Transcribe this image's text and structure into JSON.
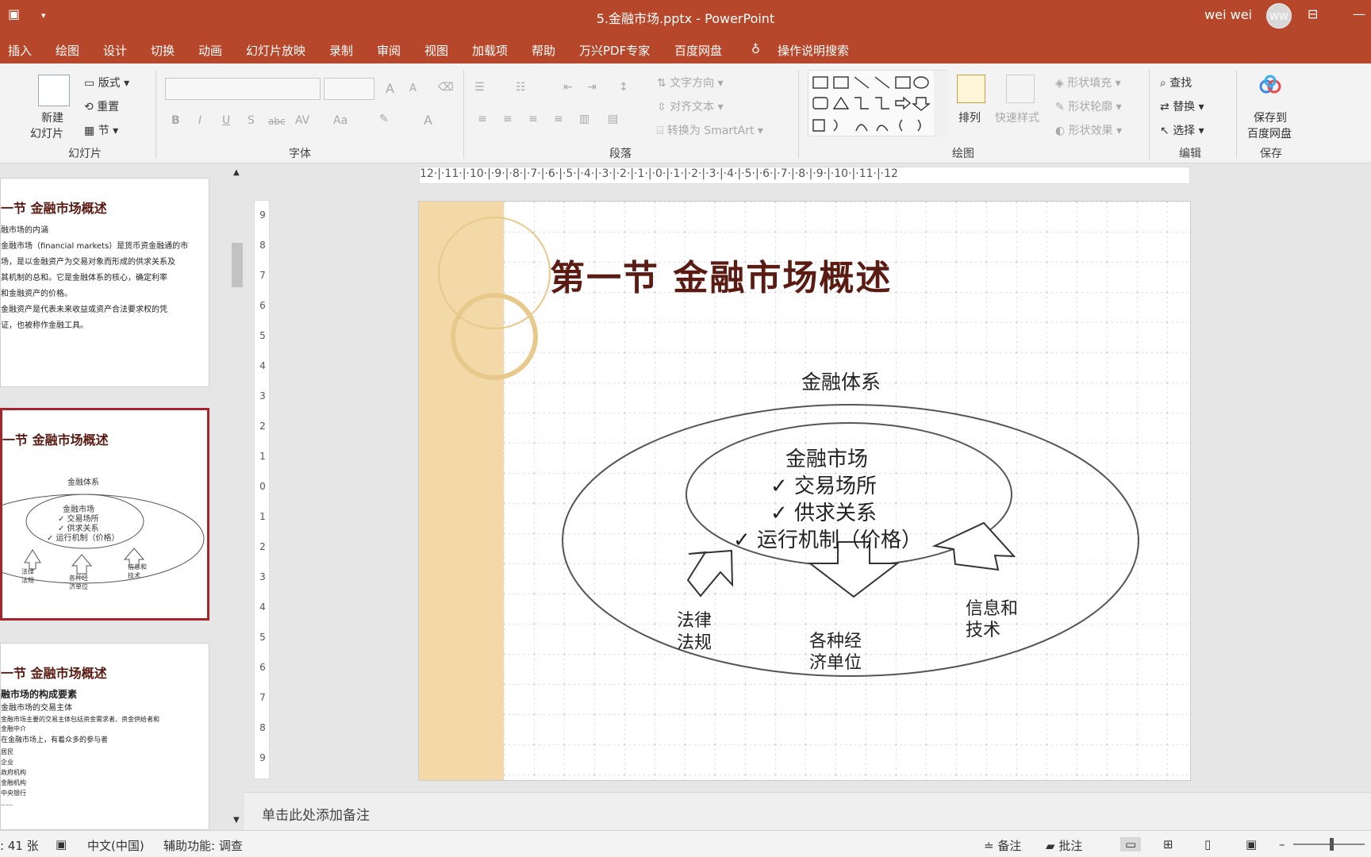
{
  "window": {
    "doc_title": "5.金融市场.pptx  -  PowerPoint",
    "user": "wei wei",
    "avatar": "WW"
  },
  "tabs": [
    "插入",
    "绘图",
    "设计",
    "切换",
    "动画",
    "幻灯片放映",
    "录制",
    "审阅",
    "视图",
    "加载项",
    "帮助",
    "万兴PDF专家",
    "百度网盘"
  ],
  "tell_me": "操作说明搜索",
  "ribbon": {
    "slides": {
      "new_slide_1": "新建",
      "new_slide_2": "幻灯片",
      "layout": "版式",
      "reset": "重置",
      "section": "节",
      "label": "幻灯片"
    },
    "font": {
      "label": "字体",
      "bold": "B",
      "italic": "I",
      "underline": "U",
      "shadow": "S",
      "strike": "abc",
      "spacing": "AV",
      "case": "Aa",
      "grow": "A",
      "shrink": "A",
      "color": "A"
    },
    "paragraph": {
      "label": "段落",
      "text_direction": "文字方向",
      "align_text": "对齐文本",
      "smartart": "转换为 SmartArt"
    },
    "drawing": {
      "label": "绘图",
      "arrange": "排列",
      "quick_styles": "快速样式",
      "fill": "形状填充",
      "outline": "形状轮廓",
      "effects": "形状效果"
    },
    "editing": {
      "label": "编辑",
      "find": "查找",
      "replace": "替换",
      "select": "选择"
    },
    "save": {
      "label": "保存",
      "btn_1": "保存到",
      "btn_2": "百度网盘"
    }
  },
  "thumbnails": [
    {
      "title": "一节 金融市场概述",
      "lines": [
        "融市场的内涵",
        "金融市场（financial markets）是货币资金融通的市",
        "场，是以金融资产为交易对象而形成的供求关系及",
        "其机制的总和。它是金融体系的核心，确定利率",
        "和金融资产的价格。",
        "金融资产是代表未来收益或资产合法要求权的凭",
        "证，也被称作金融工具。"
      ]
    },
    {
      "title": "一节 金融市场概述",
      "diagram": {
        "outer": "金融体系",
        "inner": [
          "金融市场",
          "✓ 交易场所",
          "✓ 供求关系",
          "✓ 运行机制（价格）"
        ],
        "left": "法律\n法规",
        "mid": "各种经\n济单位",
        "right": "信息和\n技术"
      }
    },
    {
      "title": "一节 金融市场概述",
      "lines": [
        "融市场的构成要素",
        "金融市场的交易主体",
        "金融市场主要的交易主体包括资金需求者、资金供给者和",
        "金融中介",
        "在金融市场上，有着众多的参与者",
        "居民",
        "企业",
        "政府机构",
        "金融机构",
        "中央银行",
        "......"
      ]
    }
  ],
  "ruler": {
    "h": "12·|·11·|·10·|·9·|·8·|·7·|·6·|·5·|·4·|·3·|·2·|·1·|·0·|·1·|·2·|·3·|·4·|·5·|·6·|·7·|·8·|·9·|·10·|·11·|·12",
    "v": [
      "9",
      "8",
      "7",
      "6",
      "5",
      "4",
      "3",
      "2",
      "1",
      "0",
      "1",
      "2",
      "3",
      "4",
      "5",
      "6",
      "7",
      "8",
      "9"
    ]
  },
  "slide": {
    "title": "第一节 金融市场概述",
    "outer_label": "金融体系",
    "inner_items": [
      "金融市场",
      "✓ 交易场所",
      "✓ 供求关系",
      "✓ 运行机制（价格）"
    ],
    "arrow_left": [
      "法律",
      "法规"
    ],
    "arrow_mid": [
      "各种经",
      "济单位"
    ],
    "arrow_right": [
      "信息和",
      "技术"
    ]
  },
  "notes_placeholder": "单击此处添加备注",
  "status": {
    "slide_count": ": 41 张",
    "language": "中文(中国)",
    "accessibility": "辅助功能: 调查",
    "notes": "备注",
    "comments": "批注"
  }
}
